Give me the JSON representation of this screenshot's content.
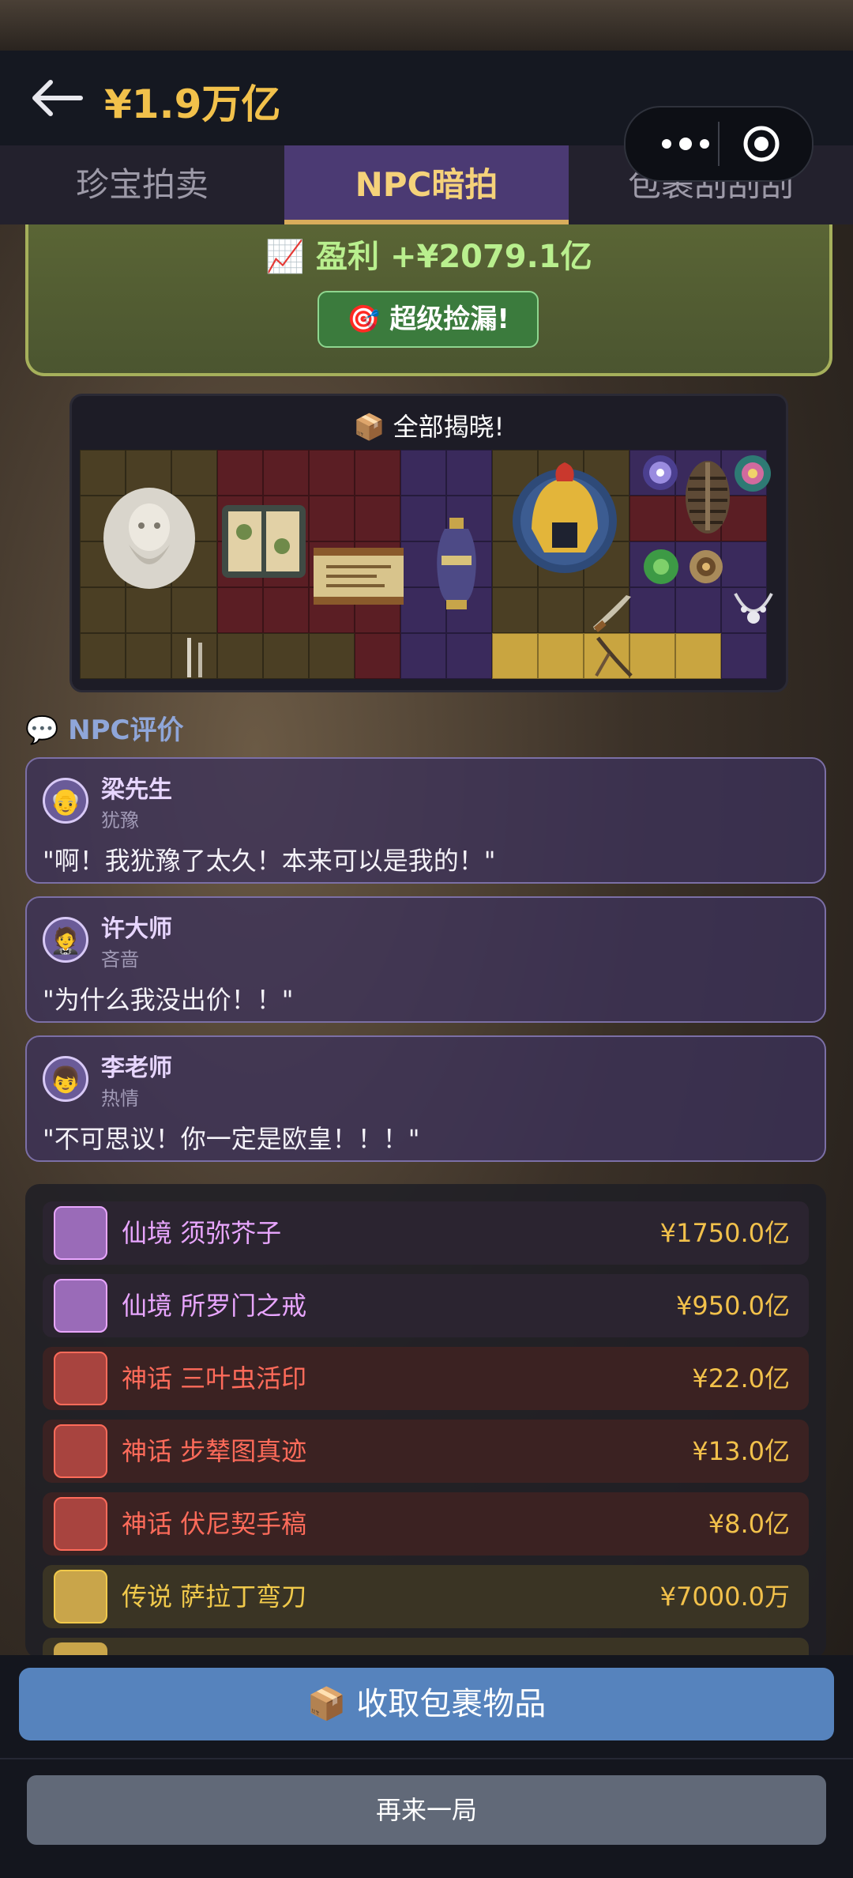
{
  "header": {
    "balance": "¥1.9万亿",
    "back_icon": "arrow-left-icon"
  },
  "tabs": [
    {
      "label": "珍宝拍卖"
    },
    {
      "label": "NPC暗拍"
    },
    {
      "label": "包裹刮刮刮"
    }
  ],
  "profit": {
    "text": "📈 盈利 +¥2079.1亿",
    "badge": "🎯 超级捡漏!"
  },
  "grid_panel": {
    "title": "📦 全部揭晓!"
  },
  "npc_section": {
    "title": "💬 NPC评价",
    "comments": [
      {
        "avatar": "👴",
        "name": "梁先生",
        "mood": "犹豫",
        "quote": "\"啊！我犹豫了太久！本来可以是我的！\""
      },
      {
        "avatar": "🤵",
        "name": "许大师",
        "mood": "吝啬",
        "quote": "\"为什么我没出价！！\""
      },
      {
        "avatar": "👦",
        "name": "李老师",
        "mood": "热情",
        "quote": "\"不可思议！你一定是欧皇！！！\""
      }
    ]
  },
  "items": [
    {
      "label": "仙境 须弥芥子",
      "price": "¥1750.0亿",
      "rarity_color": "#e9a6ff",
      "bg": "#2b2430",
      "thumb": "#9a6bb8"
    },
    {
      "label": "仙境 所罗门之戒",
      "price": "¥950.0亿",
      "rarity_color": "#e9a6ff",
      "bg": "#2b2430",
      "thumb": "#9a6bb8"
    },
    {
      "label": "神话 三叶虫活印",
      "price": "¥22.0亿",
      "rarity_color": "#ff6b5a",
      "bg": "#3b2222",
      "thumb": "#a8443f"
    },
    {
      "label": "神话 步辇图真迹",
      "price": "¥13.0亿",
      "rarity_color": "#ff6b5a",
      "bg": "#3b2222",
      "thumb": "#a8443f"
    },
    {
      "label": "神话 伏尼契手稿",
      "price": "¥8.0亿",
      "rarity_color": "#ff6b5a",
      "bg": "#3b2222",
      "thumb": "#a8443f"
    },
    {
      "label": "传说 萨拉丁弯刀",
      "price": "¥7000.0万",
      "rarity_color": "#f0c94b",
      "bg": "#3a3424",
      "thumb": "#c9a54a"
    }
  ],
  "buttons": {
    "collect": "📦 收取包裹物品",
    "again": "再来一局"
  }
}
